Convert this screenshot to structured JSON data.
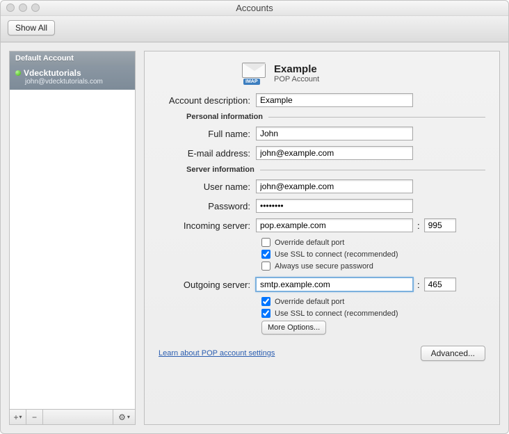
{
  "window": {
    "title": "Accounts"
  },
  "toolbar": {
    "show_all": "Show All"
  },
  "sidebar": {
    "default_header": "Default Account",
    "account": {
      "name": "Vdecktutorials",
      "email": "john@vdecktutorials.com"
    },
    "footer": {
      "add": "+",
      "dropdown": "▾",
      "remove": "−",
      "gear": "⚙",
      "gear_dropdown": "▾"
    }
  },
  "header": {
    "imap_badge": "IMAP",
    "title": "Example",
    "subtitle": "POP Account"
  },
  "labels": {
    "description": "Account description:",
    "personal": "Personal information",
    "full_name": "Full name:",
    "email": "E-mail address:",
    "server": "Server information",
    "user_name": "User name:",
    "password": "Password:",
    "incoming": "Incoming server:",
    "outgoing": "Outgoing server:",
    "override_port": "Override default port",
    "use_ssl": "Use SSL to connect (recommended)",
    "secure_pw": "Always use secure password",
    "more_options": "More Options...",
    "learn_link": "Learn about POP account settings",
    "advanced": "Advanced...",
    "colon": ":"
  },
  "values": {
    "description": "Example",
    "full_name": "John",
    "email": "john@example.com",
    "user_name": "john@example.com",
    "password": "••••••••",
    "incoming_server": "pop.example.com",
    "incoming_port": "995",
    "outgoing_server": "smtp.example.com",
    "outgoing_port": "465"
  },
  "checks": {
    "in_override": false,
    "in_ssl": true,
    "in_secure": false,
    "out_override": true,
    "out_ssl": true
  }
}
